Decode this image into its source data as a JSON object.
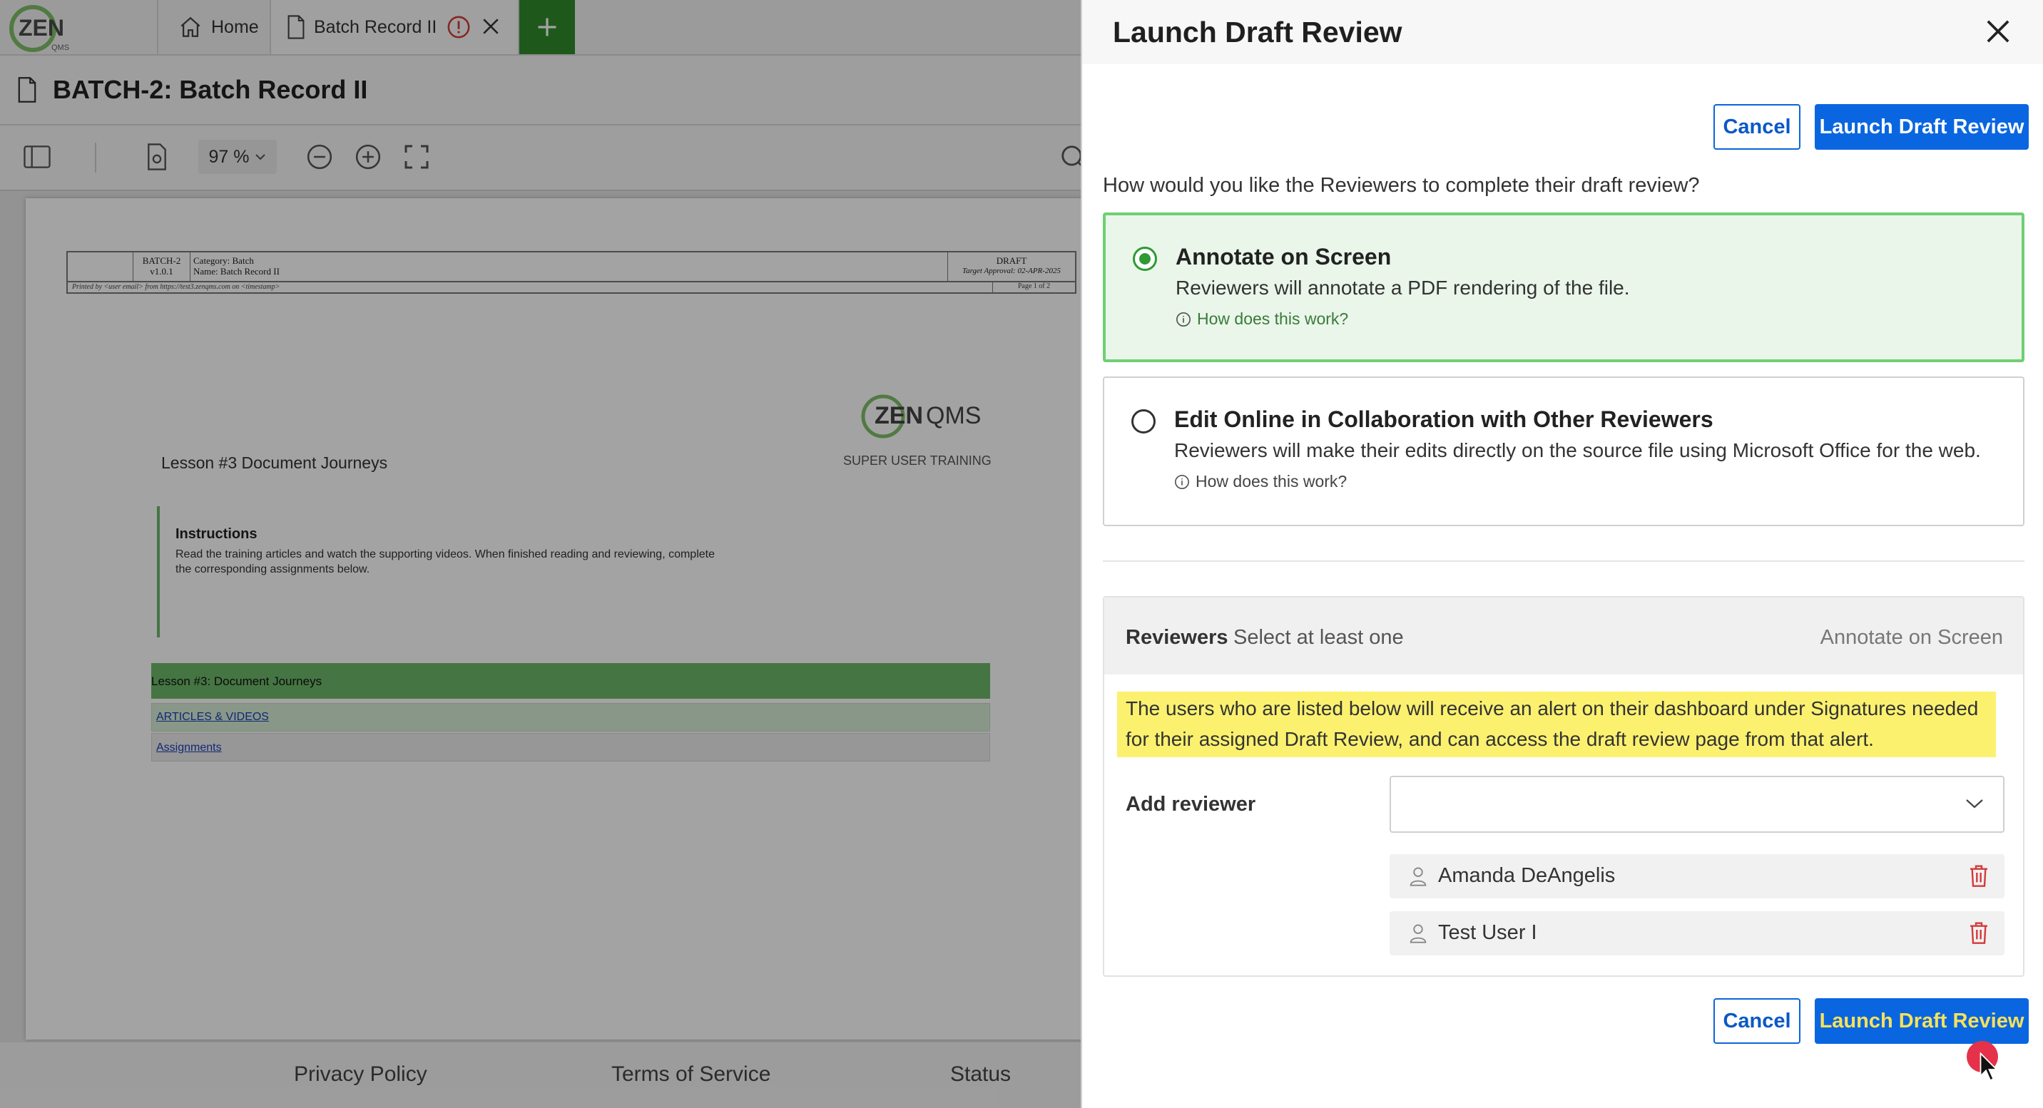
{
  "app": {
    "logo_text": "ZEN",
    "logo_sub": "QMS",
    "tabs": [
      {
        "label": "Home",
        "icon": "home-icon"
      },
      {
        "label": "Batch Record II",
        "icon": "document-icon"
      }
    ],
    "document_title": "BATCH-2: Batch Record II",
    "zoom": "97 %"
  },
  "document": {
    "header": {
      "id": "BATCH-2",
      "version": "v1.0.1",
      "category": "Category: Batch",
      "name": "Name: Batch Record II",
      "status": "DRAFT",
      "target": "Target Approval: 02-APR-2025",
      "printed": "Printed by <user email> from https://test3.zenqms.com on <timestamp>",
      "page": "Page 1 of 2"
    },
    "logo_text": "ZEN",
    "logo_text2": "QMS",
    "training_label": "SUPER USER TRAINING",
    "lesson_title": "Lesson #3 Document Journeys",
    "instructions_title": "Instructions",
    "instructions_body": "Read the training articles and watch the supporting videos. When finished reading and reviewing, complete the corresponding assignments below.",
    "lesson_bar": "Lesson #3: Document Journeys",
    "link_articles": "ARTICLES & VIDEOS",
    "link_assignments": "Assignments"
  },
  "footer": {
    "privacy": "Privacy Policy",
    "terms": "Terms of Service",
    "status": "Status"
  },
  "panel": {
    "title": "Launch Draft Review",
    "cancel_label": "Cancel",
    "launch_label": "Launch Draft Review",
    "question": "How would you like the Reviewers to complete their draft review?",
    "options": [
      {
        "title": "Annotate on Screen",
        "desc": "Reviewers will annotate a PDF rendering of the file.",
        "how": "How does this work?",
        "selected": true
      },
      {
        "title": "Edit Online in Collaboration with Other Reviewers",
        "desc": "Reviewers will make their edits directly on the source file using Microsoft Office for the web.",
        "how": "How does this work?",
        "selected": false
      }
    ],
    "reviewers": {
      "title": "Reviewers",
      "subtitle": "Select at least one",
      "mode": "Annotate on Screen",
      "notice": "The users who are listed below will receive an alert on their dashboard under Signatures needed for their assigned Draft Review, and can access the draft review page from that alert.",
      "add_label": "Add reviewer",
      "list": [
        "Amanda DeAngelis",
        "Test User I"
      ]
    }
  },
  "colors": {
    "primary": "#0a66e0",
    "selected_border": "#6fcf73",
    "selected_bg": "#e9f6e9",
    "notice_bg": "#fbf16f",
    "tab_add": "#2f8a2b",
    "danger": "#d33a3a"
  }
}
